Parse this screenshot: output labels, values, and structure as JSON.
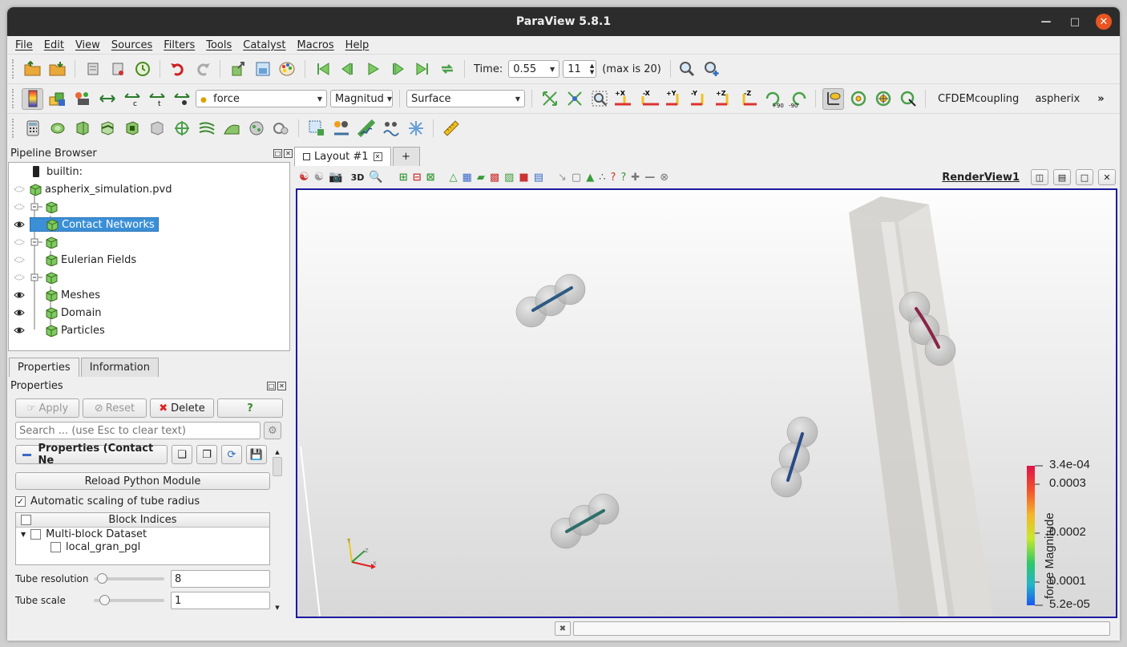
{
  "window": {
    "title": "ParaView 5.8.1"
  },
  "menu": [
    "File",
    "Edit",
    "View",
    "Sources",
    "Filters",
    "Tools",
    "Catalyst",
    "Macros",
    "Help"
  ],
  "time": {
    "label": "Time:",
    "value": "0.55",
    "step": "11",
    "max_label": "(max is 20)"
  },
  "toolbar2": {
    "array": "force",
    "component": "Magnitud",
    "representation": "Surface",
    "plugin1": "CFDEMcoupling",
    "plugin2": "aspherix",
    "more": "»"
  },
  "pipeline": {
    "title": "Pipeline Browser",
    "items": [
      {
        "label": "builtin:"
      },
      {
        "label": "aspherix_simulation.pvd"
      },
      {
        "label": ""
      },
      {
        "label": "Contact Networks",
        "selected": true
      },
      {
        "label": ""
      },
      {
        "label": "Eulerian Fields"
      },
      {
        "label": ""
      },
      {
        "label": "Meshes"
      },
      {
        "label": "Domain"
      },
      {
        "label": "Particles"
      }
    ]
  },
  "props": {
    "tabs": [
      "Properties",
      "Information"
    ],
    "title": "Properties",
    "apply": "Apply",
    "reset": "Reset",
    "delete": "Delete",
    "help": "?",
    "search_placeholder": "Search ... (use Esc to clear text)",
    "section": "Properties (Contact Ne",
    "reload": "Reload Python Module",
    "autoscale": "Automatic scaling of tube radius",
    "block_header": "Block Indices",
    "block_root": "Multi-block Dataset",
    "block_child": "local_gran_pgl",
    "tube_res_label": "Tube resolution",
    "tube_res_value": "8",
    "tube_scale_label": "Tube scale",
    "tube_scale_value": "1"
  },
  "layout": {
    "tab": "Layout #1",
    "add": "+",
    "three_d": "3D",
    "view_name": "RenderView1"
  },
  "colorbar": {
    "title": "force Magnitude",
    "ticks": [
      "3.4e-04",
      "0.0003",
      "0.0002",
      "0.0001",
      "5.2e-05"
    ],
    "range": [
      5.2e-05,
      0.00034
    ]
  },
  "colors": {
    "selection": "#3b8fd6",
    "view_border": "#1b1ba0",
    "close_button": "#e95420"
  }
}
